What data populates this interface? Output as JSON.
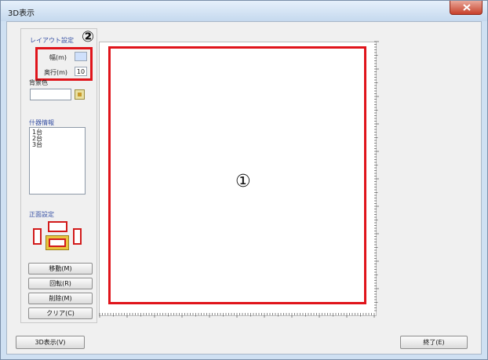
{
  "window": {
    "title": "3D表示"
  },
  "layout": {
    "title": "レイアウト設定",
    "width_label": "幅(m)",
    "width_value": "",
    "depth_label": "奥行(m)",
    "depth_value": "10",
    "background_color_label": "背景色"
  },
  "fixtures": {
    "title": "什器情報",
    "items": [
      "1台",
      "2台",
      "3台"
    ]
  },
  "orientation": {
    "title": "正面設定"
  },
  "buttons": {
    "move": "移動(M)",
    "rotate": "回転(R)",
    "delete": "削除(M)",
    "clear": "クリア(C)",
    "show_3d": "3D表示(V)",
    "exit": "終了(E)"
  },
  "annotations": {
    "canvas_marker": "①",
    "layout_marker": "②"
  },
  "colors": {
    "highlight_red": "#e0141b",
    "section_title_blue": "#3b54a6"
  },
  "icons": [
    "close-icon",
    "color-picker-icon"
  ]
}
